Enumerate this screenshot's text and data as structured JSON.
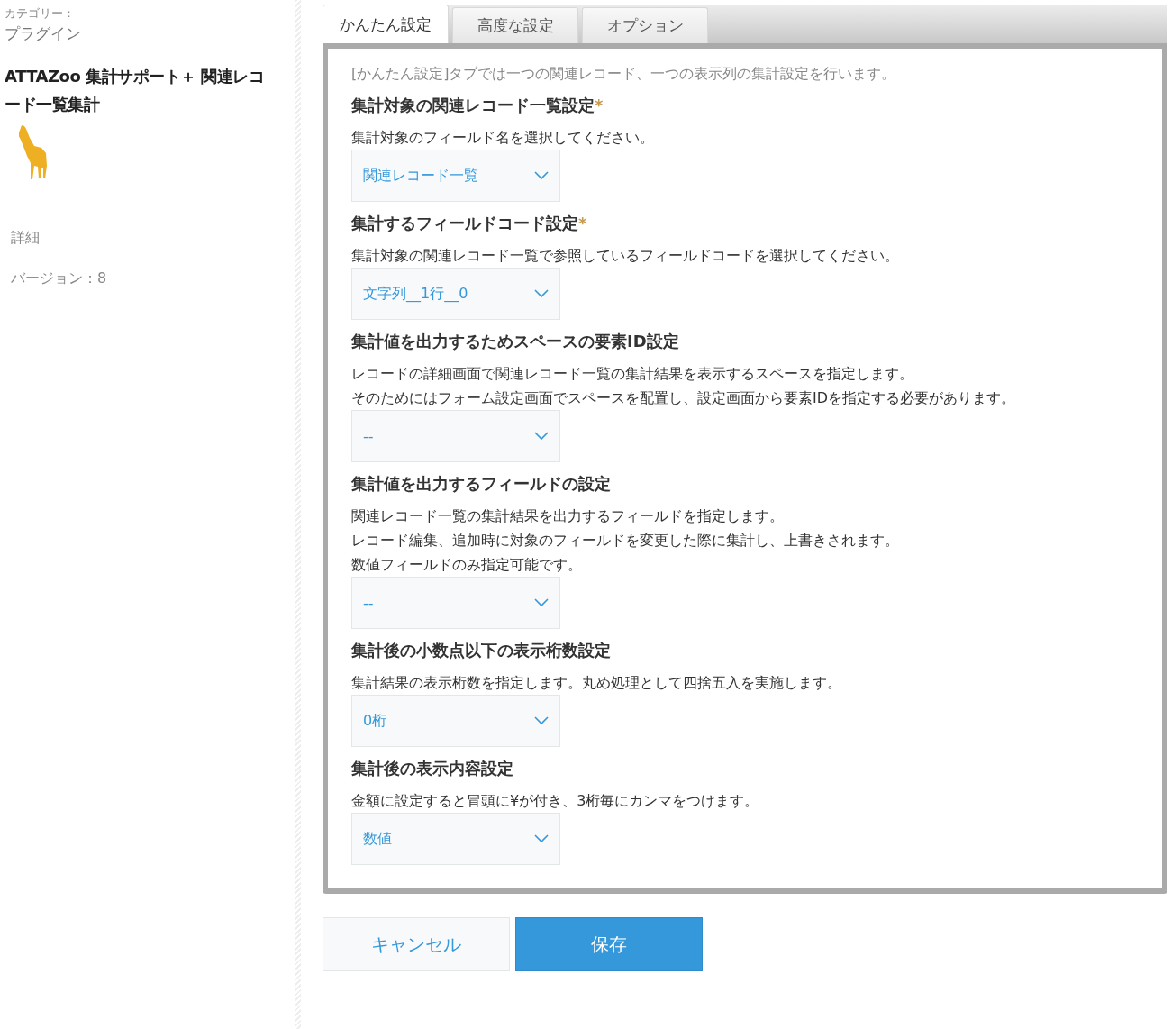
{
  "sidebar": {
    "category_label": "カテゴリー：",
    "category": "プラグイン",
    "plugin_name": "ATTAZoo 集計サポート＋ 関連レコード一覧集計",
    "details_link": "詳細",
    "version": "バージョン：8"
  },
  "tabs": [
    {
      "label": "かんたん設定",
      "selected": true
    },
    {
      "label": "高度な設定",
      "selected": false
    },
    {
      "label": "オプション",
      "selected": false
    }
  ],
  "intro": "[かんたん設定]タブでは一つの関連レコード、一つの表示列の集計設定を行います。",
  "sections": [
    {
      "title": "集計対象の関連レコード一覧設定",
      "required": true,
      "description": [
        "集計対象のフィールド名を選択してください。"
      ],
      "value": "関連レコード一覧"
    },
    {
      "title": "集計するフィールドコード設定",
      "required": true,
      "description": [
        "集計対象の関連レコード一覧で参照しているフィールドコードを選択してください。"
      ],
      "value": "文字列__1行__0"
    },
    {
      "title": "集計値を出力するためスペースの要素ID設定",
      "required": false,
      "description": [
        "レコードの詳細画面で関連レコード一覧の集計結果を表示するスペースを指定します。",
        "そのためにはフォーム設定画面でスペースを配置し、設定画面から要素IDを指定する必要があります。"
      ],
      "value": "--"
    },
    {
      "title": "集計値を出力するフィールドの設定",
      "required": false,
      "description": [
        "関連レコード一覧の集計結果を出力するフィールドを指定します。",
        "レコード編集、追加時に対象のフィールドを変更した際に集計し、上書きされます。",
        "数値フィールドのみ指定可能です。"
      ],
      "value": "--"
    },
    {
      "title": "集計後の小数点以下の表示桁数設定",
      "required": false,
      "description": [
        "集計結果の表示桁数を指定します。丸め処理として四捨五入を実施します。"
      ],
      "value": "0桁"
    },
    {
      "title": "集計後の表示内容設定",
      "required": false,
      "description": [
        "金額に設定すると冒頭に¥が付き、3桁毎にカンマをつけます。"
      ],
      "value": "数値"
    }
  ],
  "required_mark": "*",
  "buttons": [
    {
      "label": "キャンセル",
      "kind": "cancel"
    },
    {
      "label": "保存",
      "kind": "save"
    }
  ]
}
